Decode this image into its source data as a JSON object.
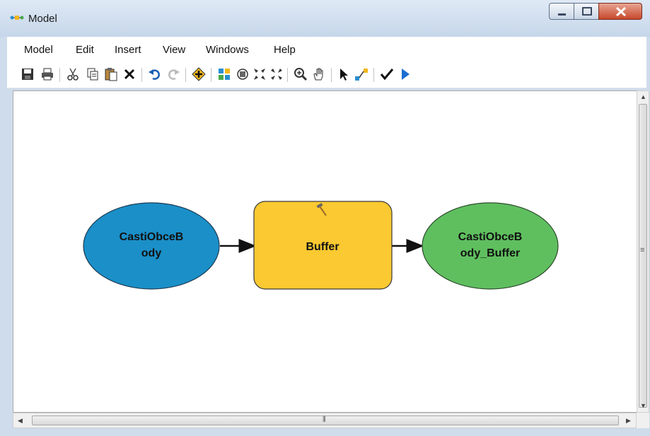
{
  "window": {
    "title": "Model"
  },
  "menu": {
    "items": [
      "Model",
      "Edit",
      "Insert",
      "View",
      "Windows",
      "Help"
    ]
  },
  "toolbar": {
    "icons": [
      "save-icon",
      "print-icon",
      "cut-icon",
      "copy-icon",
      "paste-icon",
      "delete-icon",
      "undo-icon",
      "redo-icon",
      "add-data-icon",
      "auto-layout-icon",
      "full-extent-icon",
      "zoom-in-fixed-icon",
      "zoom-out-fixed-icon",
      "zoom-icon",
      "pan-icon",
      "select-icon",
      "connect-icon",
      "validate-icon",
      "run-icon"
    ]
  },
  "diagram": {
    "input_node": {
      "line1": "CastiObceB",
      "line2": "ody",
      "color": "#1a8fc8"
    },
    "tool_node": {
      "label": "Buffer",
      "color": "#fbc931"
    },
    "output_node": {
      "line1": "CastiObceB",
      "line2": "ody_Buffer",
      "color": "#5fbf5f"
    }
  },
  "colors": {
    "accent_run": "#1a6fd0",
    "close_button": "#c7472b"
  }
}
